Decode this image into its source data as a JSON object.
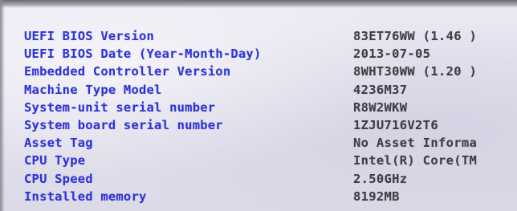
{
  "bios_info": {
    "items": [
      {
        "label": "UEFI BIOS Version",
        "value": "83ET76WW (1.46 )"
      },
      {
        "label": "UEFI BIOS Date (Year-Month-Day)",
        "value": "2013-07-05"
      },
      {
        "label": "Embedded Controller Version",
        "value": "8WHT30WW (1.20 )"
      },
      {
        "label": "Machine Type Model",
        "value": "4236M37"
      },
      {
        "label": "System-unit serial number",
        "value": "R8W2WKW"
      },
      {
        "label": "System board serial number",
        "value": "1ZJU716V2T6"
      },
      {
        "label": "Asset Tag",
        "value": "No Asset Informa"
      },
      {
        "label": "CPU Type",
        "value": "Intel(R) Core(TM"
      },
      {
        "label": "CPU Speed",
        "value": "2.50GHz"
      },
      {
        "label": "Installed memory",
        "value": "8192MB"
      }
    ]
  },
  "colors": {
    "label": "#2f34d6",
    "value": "#3e3e44",
    "background": "#e6e4ef"
  }
}
